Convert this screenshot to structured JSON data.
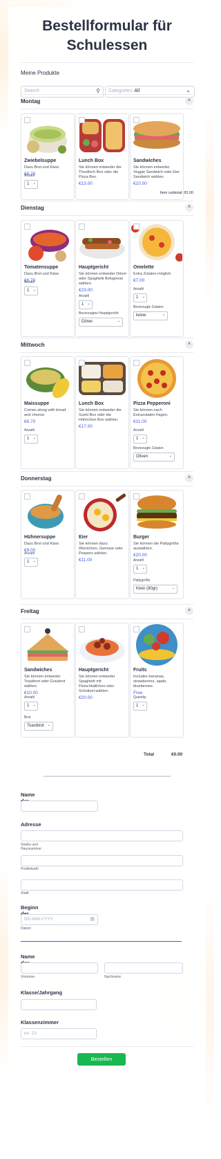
{
  "form": {
    "title_line1": "Bestellformular für",
    "title_line2": "Schulessen",
    "products_label": "Meine Produkte",
    "search_placeholder": "Search",
    "categories_label": "Categories:",
    "categories_value": "All",
    "qty_label": "Anzahl",
    "qty_label_en": "Quantity",
    "qty_value": "1"
  },
  "days": [
    {
      "name": "Montag",
      "products": [
        {
          "name": "Zwiebelsuppe",
          "desc": "Dazu Brot und Käse.",
          "price": "€6.70"
        },
        {
          "name": "Lunch Box",
          "desc": "Sie können entweder die Thunfisch Box oder die Pizza Box.",
          "price": "€13.00"
        },
        {
          "name": "Sandwiches",
          "desc": "Sie können entweder Veggie Sandwich oder Eier Sandwich wählen.",
          "price": "€10.00"
        }
      ]
    },
    {
      "name": "Dienstag",
      "products": [
        {
          "name": "Tomatensuppe",
          "desc": "Dazu Brot und Käse.",
          "price": "€6.70"
        },
        {
          "name": "Hauptgericht",
          "desc": "Sie können entweder Döner oder Spaghetti Bolognese wählen.",
          "price": "€23.00",
          "opt_label": "Bevorzugtes Hauptgericht",
          "opt_value": "Döner"
        },
        {
          "name": "Omelette",
          "desc": "Extra Zutaten möglich.",
          "price": "€7.00",
          "opt_label": "Bevorzugte Zutaten",
          "opt_value": "keine"
        }
      ]
    },
    {
      "name": "Mittwoch",
      "products": [
        {
          "name": "Maissuppe",
          "desc": "Comes along with bread and cheese.",
          "price": "€6.70"
        },
        {
          "name": "Lunch Box",
          "desc": "Sie können entweder die  Sushi Box oder die Hühnchen Box wählen.",
          "price": "€17.00"
        },
        {
          "name": "Pizza Pepperoni",
          "desc": "Sie können nach Extrazutaten fragen.",
          "price": "€11.00",
          "opt_label": "Bevorzugte Zutaten",
          "opt_value": "Oliven"
        }
      ]
    },
    {
      "name": "Donnerstag",
      "products": [
        {
          "name": "Hühnersuppe",
          "desc": "Dazu Brot und Käse.",
          "price": "€9.00"
        },
        {
          "name": "Eier",
          "desc": "Sie können dazu Würstchen, Gemüse oder Peepers wählen.",
          "price": "€11.00"
        },
        {
          "name": "Burger",
          "desc": "Sie können die Pattygröße auswählen.",
          "price": "€20.00",
          "opt_label": "Pattygröße",
          "opt_value": "Klein (90gr)"
        }
      ]
    },
    {
      "name": "Freitag",
      "products": [
        {
          "name": "Sandwiches",
          "desc": "Sie können entweder Toastbrot oder Graubrot wählen.",
          "price": "€10.00",
          "opt_label": "Brot",
          "opt_value": "Toastbrot"
        },
        {
          "name": "Hauptgericht",
          "desc": "Sie können entweder Spaghetti mit Fleischbällchen oder Schnitzel wählen.",
          "price": "€20.00"
        },
        {
          "name": "Fruits",
          "desc": "Includes bananas, strawberries, apple, blueberries.",
          "price": "Free"
        }
      ]
    }
  ],
  "subtotal": "Item subtotal: €0.00",
  "total_label": "Total",
  "total_value": "€0.00",
  "school": {
    "label": "Name der Schule"
  },
  "address": {
    "label": "Adresse",
    "street_sub": "Straße und Hausnummer",
    "zip_sub": "Postleitzahl",
    "city_sub": "Stadt"
  },
  "start": {
    "label": "Beginn der Bestellung",
    "placeholder": "DD-MM-YYYY",
    "sub": "Datum"
  },
  "student": {
    "label": "Name des Schülers",
    "first_sub": "Vorname",
    "last_sub": "Nachname"
  },
  "class": {
    "label": "Klasse/Jahrgang"
  },
  "room": {
    "label": "Klassenzimmer",
    "placeholder": "ex: 23"
  },
  "submit": {
    "label": "Bestellen"
  },
  "colors": {
    "accent": "#3c5ee0",
    "submit": "#18b850"
  }
}
